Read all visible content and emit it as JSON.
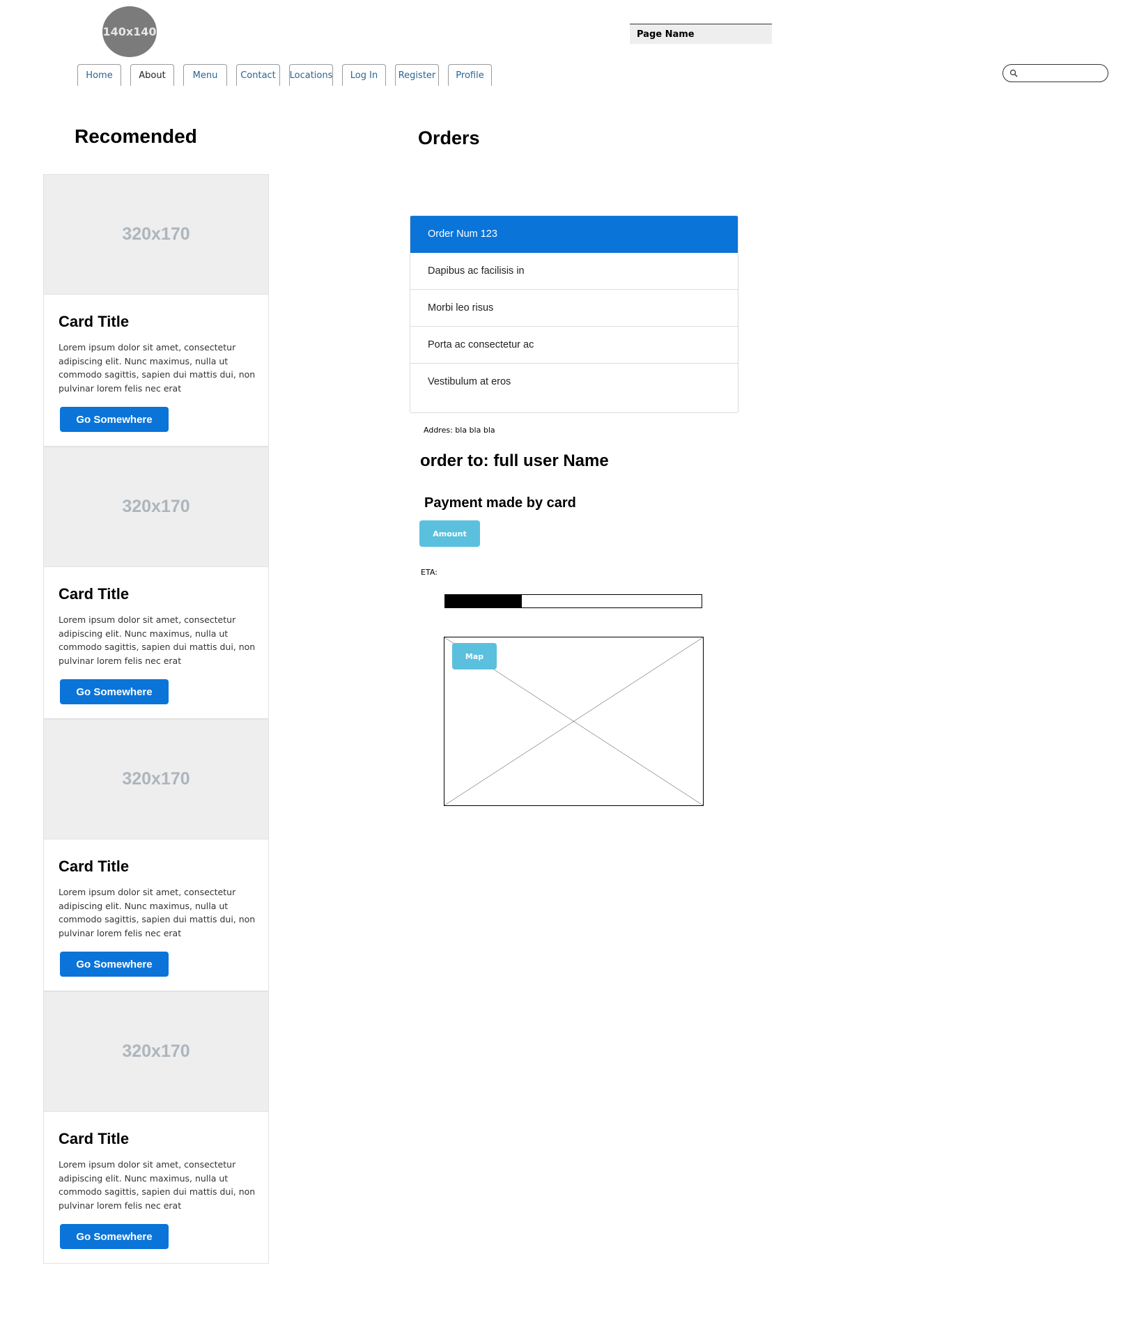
{
  "header": {
    "avatar_label": "140x140",
    "page_name": "Page Name",
    "nav": [
      {
        "label": "Home"
      },
      {
        "label": "About"
      },
      {
        "label": "Menu"
      },
      {
        "label": "Contact"
      },
      {
        "label": "Locations"
      },
      {
        "label": "Log In"
      },
      {
        "label": "Register"
      },
      {
        "label": "Profile"
      }
    ],
    "active_tab": "About",
    "search": {
      "value": "",
      "placeholder": "",
      "icon": "search-icon"
    }
  },
  "recommended": {
    "heading": "Recomended",
    "cards": [
      {
        "image_label": "320x170",
        "title": "Card Title",
        "text": "Lorem ipsum dolor sit amet, consectetur adipiscing elit. Nunc maximus, nulla ut commodo sagittis, sapien dui mattis dui, non pulvinar lorem felis nec erat",
        "button": "Go Somewhere"
      },
      {
        "image_label": "320x170",
        "title": "Card Title",
        "text": "Lorem ipsum dolor sit amet, consectetur adipiscing elit. Nunc maximus, nulla ut commodo sagittis, sapien dui mattis dui, non pulvinar lorem felis nec erat",
        "button": "Go Somewhere"
      },
      {
        "image_label": "320x170",
        "title": "Card Title",
        "text": "Lorem ipsum dolor sit amet, consectetur adipiscing elit. Nunc maximus, nulla ut commodo sagittis, sapien dui mattis dui, non pulvinar lorem felis nec erat",
        "button": "Go Somewhere"
      },
      {
        "image_label": "320x170",
        "title": "Card Title",
        "text": "Lorem ipsum dolor sit amet, consectetur adipiscing elit. Nunc maximus, nulla ut commodo sagittis, sapien dui mattis dui, non pulvinar lorem felis nec erat",
        "button": "Go Somewhere"
      }
    ]
  },
  "orders": {
    "heading": "Orders",
    "items": [
      {
        "label": "Order Num 123",
        "active": true
      },
      {
        "label": "Dapibus ac facilisis in"
      },
      {
        "label": "Morbi leo risus"
      },
      {
        "label": "Porta ac consectetur ac"
      },
      {
        "label": "Vestibulum at eros"
      }
    ],
    "address": "Addres: bla bla bla",
    "order_to": "order to: full user Name",
    "payment": "Payment made by card",
    "amount_button": "Amount",
    "eta_label": "ETA:",
    "eta_progress_percent": 30,
    "map_button": "Map"
  },
  "colors": {
    "primary": "#0a74d8",
    "info": "#5bc0de",
    "placeholder_bg": "#eeeeee",
    "avatar_bg": "#7b7b7b"
  }
}
